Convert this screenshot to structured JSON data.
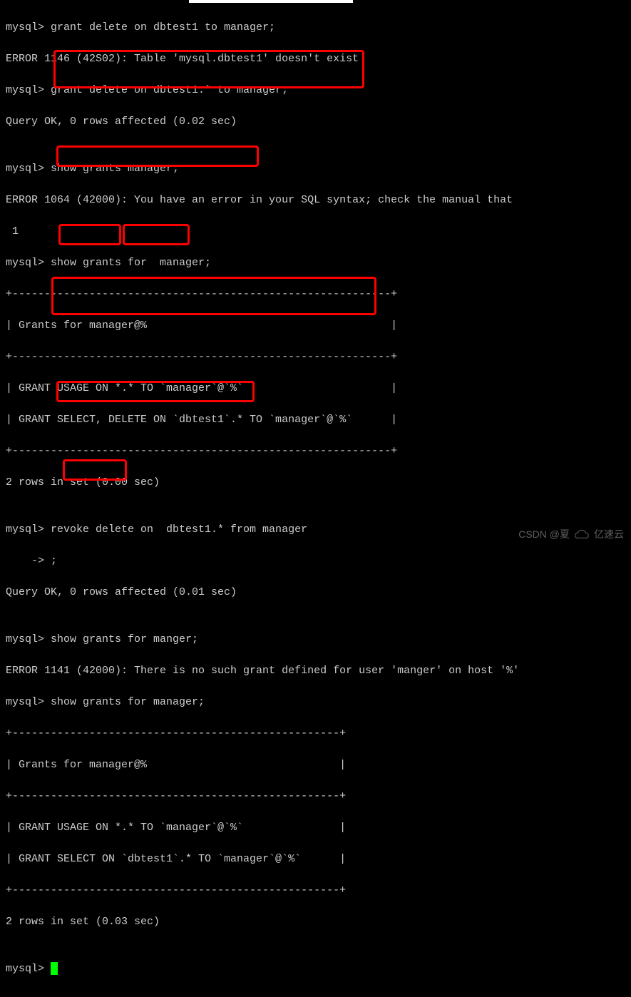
{
  "lines": {
    "l1": "mysql> grant delete on dbtest1 to manager;",
    "l2": "ERROR 1146 (42S02): Table 'mysql.dbtest1' doesn't exist",
    "l3": "mysql> grant delete on dbtest1.* to manager;",
    "l4": "Query OK, 0 rows affected (0.02 sec)",
    "l5": "",
    "l6": "mysql> show grants manager;",
    "l7": "ERROR 1064 (42000): You have an error in your SQL syntax; check the manual that",
    "l7b": " 1",
    "l8": "mysql> show grants for  manager;",
    "l9": "+-----------------------------------------------------------+",
    "l10": "| Grants for manager@%                                      |",
    "l11": "+-----------------------------------------------------------+",
    "l12": "| GRANT USAGE ON *.* TO `manager`@`%`                       |",
    "l13": "| GRANT SELECT, DELETE ON `dbtest1`.* TO `manager`@`%`      |",
    "l14": "+-----------------------------------------------------------+",
    "l15": "2 rows in set (0.00 sec)",
    "l16": "",
    "l17": "mysql> revoke delete on  dbtest1.* from manager",
    "l18": "    -> ;",
    "l19": "Query OK, 0 rows affected (0.01 sec)",
    "l20": "",
    "l21": "mysql> show grants for manger;",
    "l22": "ERROR 1141 (42000): There is no such grant defined for user 'manger' on host '%'",
    "l23": "mysql> show grants for manager;",
    "l24": "+---------------------------------------------------+",
    "l25": "| Grants for manager@%                              |",
    "l26": "+---------------------------------------------------+",
    "l27": "| GRANT USAGE ON *.* TO `manager`@`%`               |",
    "l28": "| GRANT SELECT ON `dbtest1`.* TO `manager`@`%`      |",
    "l29": "+---------------------------------------------------+",
    "l30": "2 rows in set (0.03 sec)",
    "l31": "",
    "l32": "mysql> "
  },
  "watermark": {
    "csdn": "CSDN @夏",
    "brand": "亿速云"
  }
}
